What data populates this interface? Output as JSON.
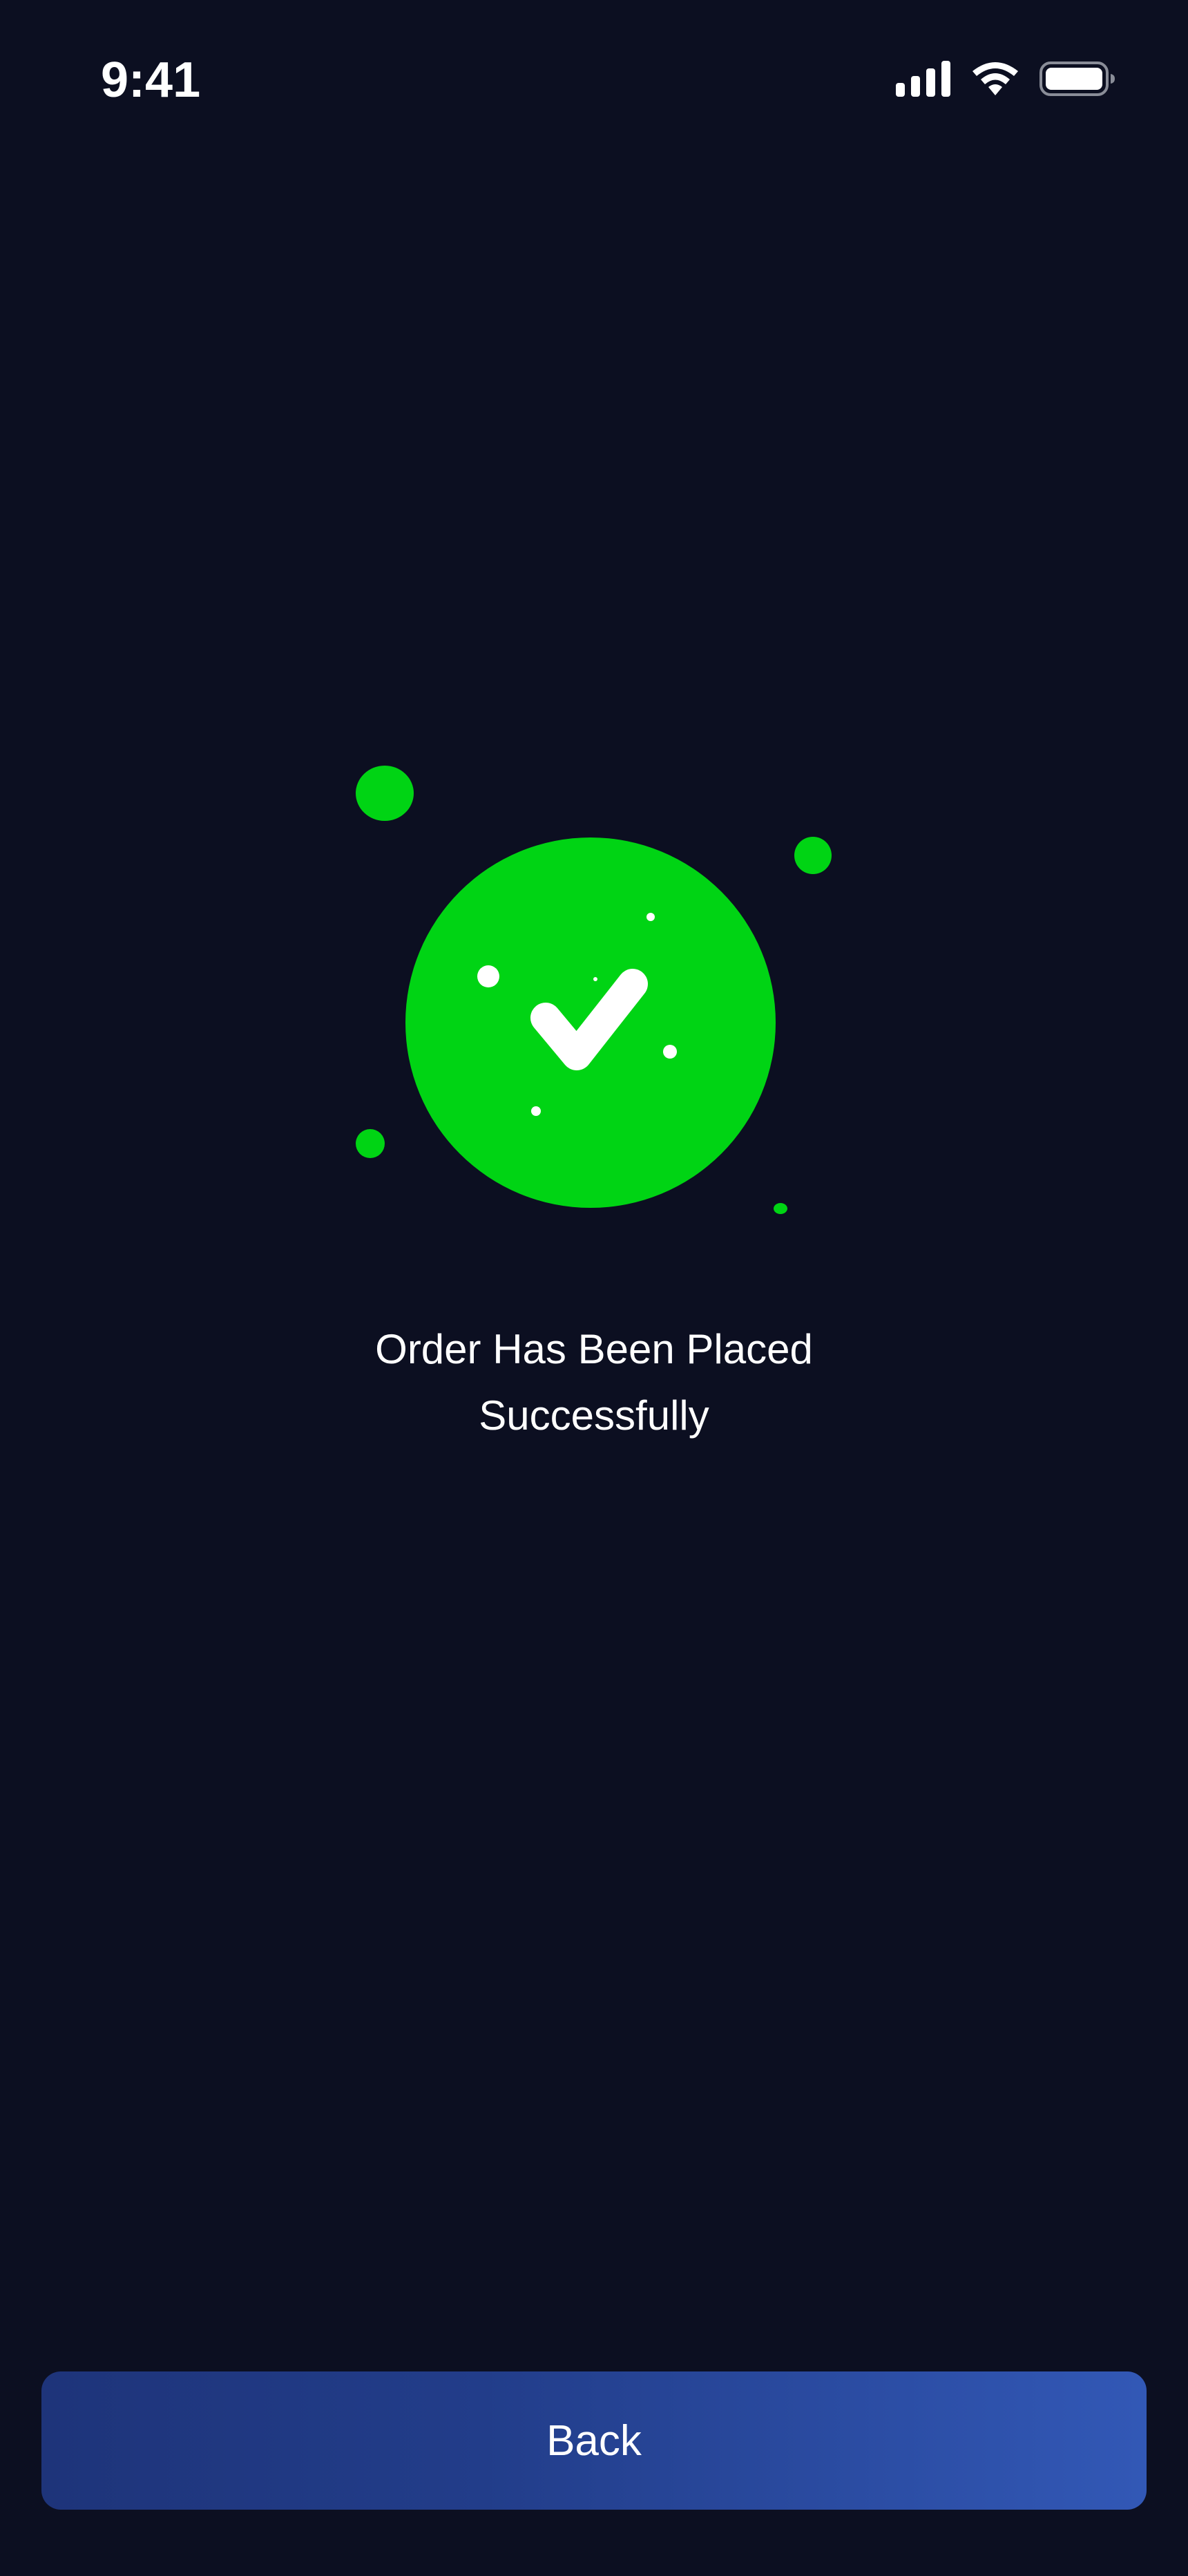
{
  "status_bar": {
    "time": "9:41",
    "icons": [
      "signal-icon",
      "wifi-icon",
      "battery-icon"
    ]
  },
  "success": {
    "icon": "checkmark-icon",
    "message": "Order Has Been Placed\nSuccessfully",
    "accent_color": "#00d414"
  },
  "actions": {
    "back_label": "Back"
  },
  "colors": {
    "background": "#0c0f21",
    "button_gradient_start": "#1e347a",
    "button_gradient_end": "#3258b6",
    "text": "#ffffff"
  }
}
